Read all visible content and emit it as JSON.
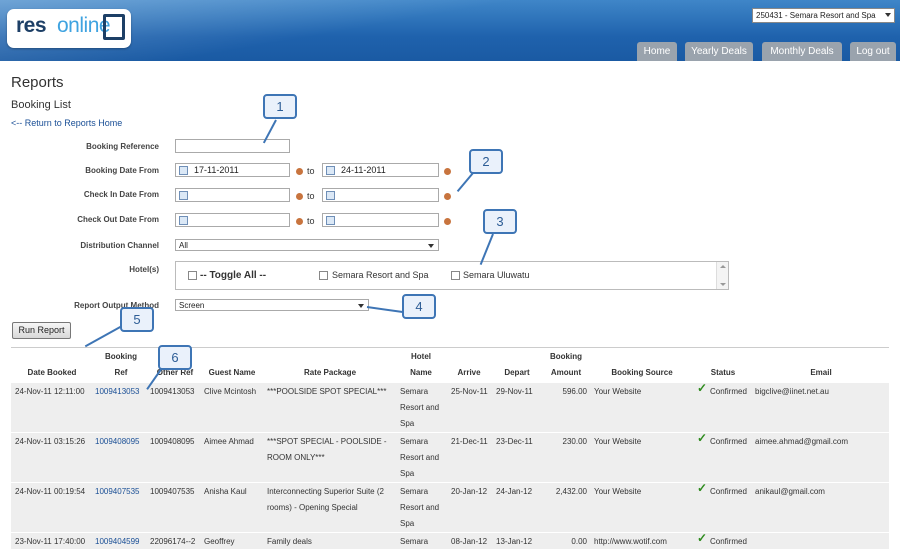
{
  "header": {
    "brand_bold": "res",
    "brand_light": "online",
    "property_select": "250431 - Semara Resort and Spa",
    "nav": [
      "Home",
      "Yearly Deals",
      "Monthly Deals",
      "Log out"
    ]
  },
  "page": {
    "title": "Reports",
    "subtitle": "Booking List",
    "return_link": "<-- Return to Reports Home"
  },
  "form": {
    "booking_reference_label": "Booking Reference",
    "booking_reference_value": "",
    "booking_date_label": "Booking Date From",
    "booking_date_from": "17-11-2011",
    "booking_date_to": "24-11-2011",
    "checkin_label": "Check In Date From",
    "checkin_from": "",
    "checkin_to": "",
    "checkout_label": "Check Out Date From",
    "checkout_from": "",
    "checkout_to": "",
    "to_text": "to",
    "channel_label": "Distribution Channel",
    "channel_value": "All",
    "hotels_label": "Hotel(s)",
    "toggle_all": "-- Toggle All --",
    "hotels": [
      "Semara Resort and Spa",
      "Semara Uluwatu"
    ],
    "output_label": "Report Output Method",
    "output_value": "Screen",
    "run_button": "Run Report"
  },
  "callouts": [
    "1",
    "2",
    "3",
    "4",
    "5",
    "6"
  ],
  "table": {
    "headers": {
      "date_booked": "Date Booked",
      "booking_ref_1": "Booking",
      "booking_ref_2": "Ref",
      "other_ref": "Other Ref",
      "guest_name": "Guest Name",
      "rate_package": "Rate Package",
      "hotel_name_1": "Hotel",
      "hotel_name_2": "Name",
      "arrive": "Arrive",
      "depart": "Depart",
      "amount_1": "Booking",
      "amount_2": "Amount",
      "source": "Booking Source",
      "status": "Status",
      "email": "Email"
    },
    "rows": [
      {
        "date": "24-Nov-11 12:11:00",
        "ref": "1009413053",
        "other": "1009413053",
        "guest": "Clive Mcintosh",
        "rate1": "***POOLSIDE SPOT SPECIAL***",
        "rate2": "",
        "hotel1": "Semara",
        "hotel2": "Resort and",
        "hotel3": "Spa",
        "arrive": "25-Nov-11",
        "depart": "29-Nov-11",
        "amount": "596.00",
        "source": "Your Website",
        "status": "Confirmed",
        "email": "bigclive@iinet.net.au"
      },
      {
        "date": "24-Nov-11 03:15:26",
        "ref": "1009408095",
        "other": "1009408095",
        "guest": "Aimee Ahmad",
        "rate1": "***SPOT SPECIAL - POOLSIDE -",
        "rate2": "ROOM ONLY***",
        "hotel1": "Semara",
        "hotel2": "Resort and",
        "hotel3": "Spa",
        "arrive": "21-Dec-11",
        "depart": "23-Dec-11",
        "amount": "230.00",
        "source": "Your Website",
        "status": "Confirmed",
        "email": "aimee.ahmad@gmail.com"
      },
      {
        "date": "24-Nov-11 00:19:54",
        "ref": "1009407535",
        "other": "1009407535",
        "guest": "Anisha Kaul",
        "rate1": "Interconnecting Superior Suite (2",
        "rate2": "rooms) - Opening Special",
        "hotel1": "Semara",
        "hotel2": "Resort and",
        "hotel3": "Spa",
        "arrive": "20-Jan-12",
        "depart": "24-Jan-12",
        "amount": "2,432.00",
        "source": "Your Website",
        "status": "Confirmed",
        "email": "anikaul@gmail.com"
      },
      {
        "date": "23-Nov-11 17:40:00",
        "ref": "1009404599",
        "other": "22096174--2",
        "guest": "Geoffrey",
        "rate1": "Family deals",
        "rate2": "",
        "hotel1": "Semara",
        "hotel2": "",
        "hotel3": "",
        "arrive": "08-Jan-12",
        "depart": "13-Jan-12",
        "amount": "0.00",
        "source": "http://www.wotif.com",
        "status": "Confirmed",
        "email": ""
      }
    ]
  }
}
